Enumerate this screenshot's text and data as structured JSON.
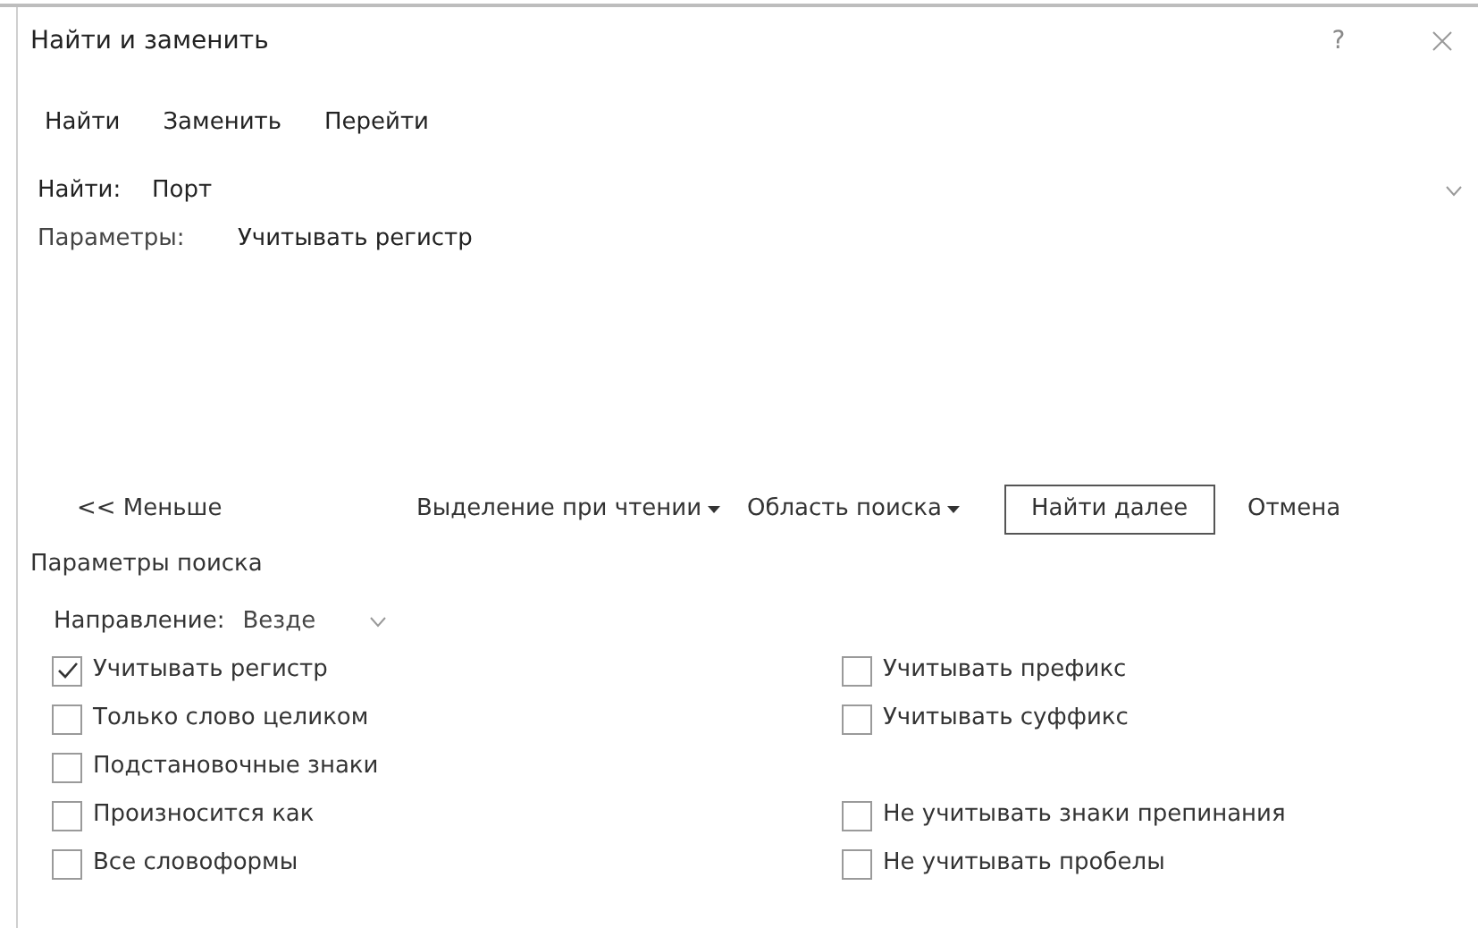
{
  "window": {
    "title": "Найти и заменить",
    "help": "?"
  },
  "tabs": [
    {
      "label": "Найти"
    },
    {
      "label": "Заменить"
    },
    {
      "label": "Перейти"
    }
  ],
  "find": {
    "label": "Найти:",
    "value": "Порт"
  },
  "parameters": {
    "label": "Параметры:",
    "value": "Учитывать регистр"
  },
  "buttons": [
    {
      "label": "<< Меньше",
      "kind": "plain"
    },
    {
      "label": "Выделение при чтении",
      "kind": "menu"
    },
    {
      "label": "Область поиска",
      "kind": "menu"
    },
    {
      "label": "Найти далее",
      "kind": "default"
    },
    {
      "label": "Отмена",
      "kind": "plain"
    }
  ],
  "search_options": {
    "title": "Параметры поиска",
    "direction": {
      "label": "Направление:",
      "value": "Везде"
    },
    "left": [
      {
        "label": "Учитывать регистр",
        "checked": true
      },
      {
        "label": "Только слово целиком",
        "checked": false
      },
      {
        "label": "Подстановочные знаки",
        "checked": false
      },
      {
        "label": "Произносится как",
        "checked": false
      },
      {
        "label": "Все словоформы",
        "checked": false
      }
    ],
    "right": [
      {
        "label": "Учитывать префикс",
        "checked": false
      },
      {
        "label": "Учитывать суффикс",
        "checked": false
      },
      {
        "label": "Не учитывать знаки препинания",
        "checked": false
      },
      {
        "label": "Не учитывать пробелы",
        "checked": false
      }
    ]
  }
}
